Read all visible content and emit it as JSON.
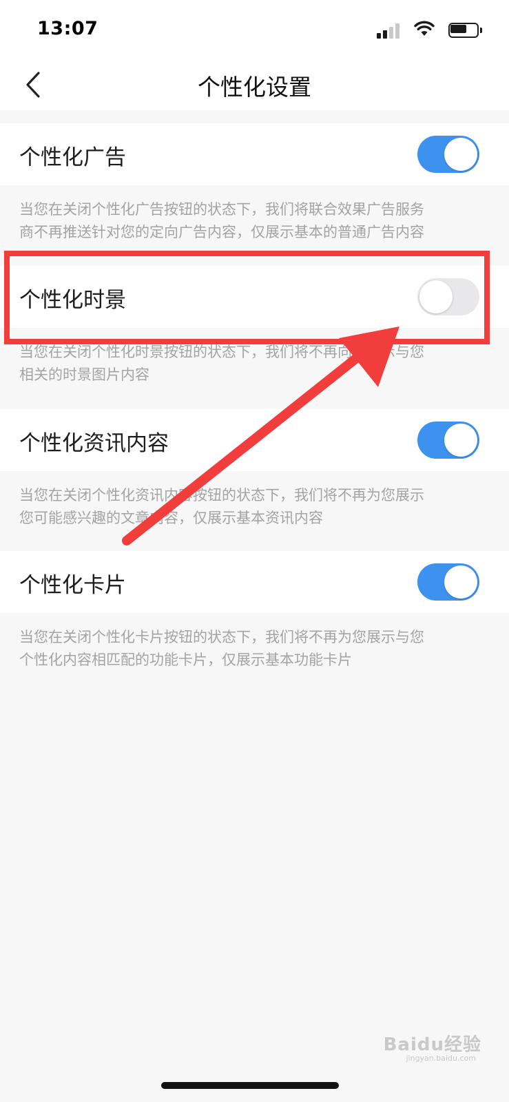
{
  "status_bar": {
    "time": "13:07",
    "icons": [
      "signal-icon",
      "wifi-icon",
      "battery-icon"
    ]
  },
  "nav": {
    "back_icon": "chevron-left-icon",
    "title": "个性化设置"
  },
  "settings": [
    {
      "label": "个性化广告",
      "enabled": true,
      "description_lines": [
        "当您在关闭个性化广告按钮的状态下，我们将联合效果广告服务",
        "商不再推送针对您的定向广告内容，仅展示基本的普通广告内容"
      ]
    },
    {
      "label": "个性化时景",
      "enabled": false,
      "description_lines": [
        "当您在关闭个性化时景按钮的状态下，我们将不再向您展示与您",
        "相关的时景图片内容"
      ]
    },
    {
      "label": "个性化资讯内容",
      "enabled": true,
      "description_lines": [
        "当您在关闭个性化资讯内容按钮的状态下，我们将不再为您展示",
        "您可能感兴趣的文章内容，仅展示基本资讯内容"
      ]
    },
    {
      "label": "个性化卡片",
      "enabled": true,
      "description_lines": [
        "当您在关闭个性化卡片按钮的状态下，我们将不再为您展示与您",
        "个性化内容相匹配的功能卡片，仅展示基本功能卡片"
      ]
    }
  ],
  "colors": {
    "toggle_on": "#3e92ef",
    "toggle_off": "#e8e8ea",
    "annotation": "#f23d3d",
    "background": "#f7f7f8"
  },
  "watermark": {
    "text": "Baidu经验",
    "subtext": "jingyan.baidu.com"
  }
}
